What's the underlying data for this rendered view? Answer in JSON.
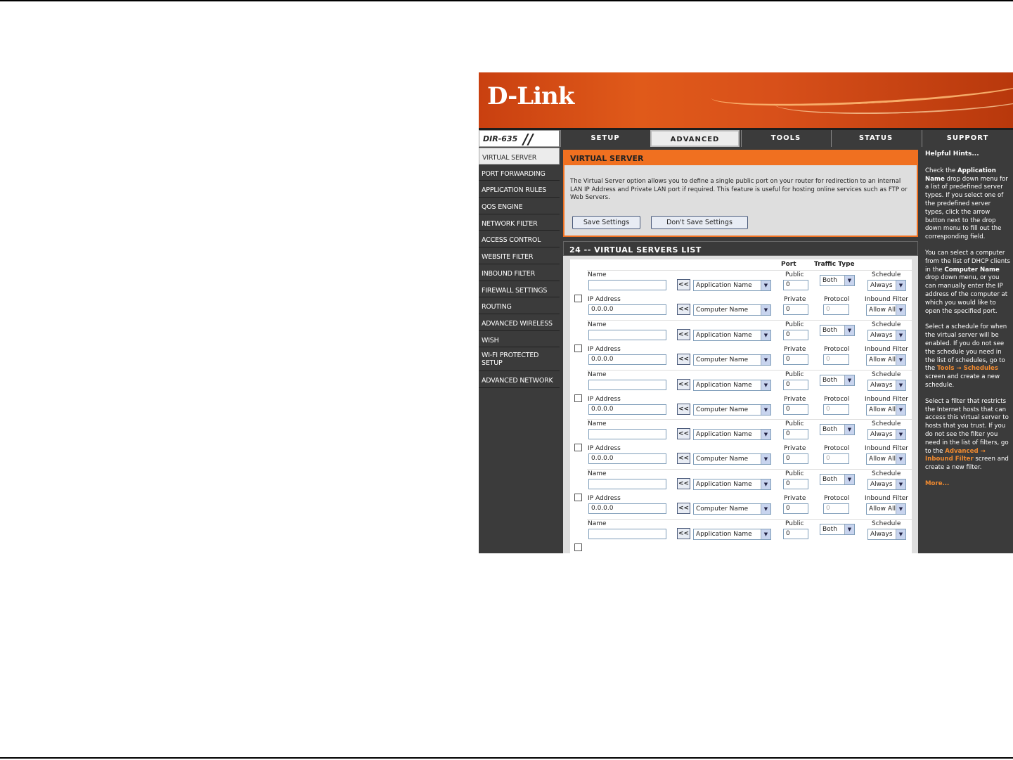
{
  "brand": {
    "logo": "D-Link",
    "model": "DIR-635"
  },
  "tabs": [
    "SETUP",
    "ADVANCED",
    "TOOLS",
    "STATUS",
    "SUPPORT"
  ],
  "active_tab": "ADVANCED",
  "sidebar": {
    "items": [
      {
        "label": "VIRTUAL SERVER"
      },
      {
        "label": "PORT FORWARDING"
      },
      {
        "label": "APPLICATION RULES"
      },
      {
        "label": "QOS ENGINE"
      },
      {
        "label": "NETWORK FILTER"
      },
      {
        "label": "ACCESS CONTROL"
      },
      {
        "label": "WEBSITE FILTER"
      },
      {
        "label": "INBOUND FILTER"
      },
      {
        "label": "FIREWALL SETTINGS"
      },
      {
        "label": "ROUTING"
      },
      {
        "label": "ADVANCED WIRELESS"
      },
      {
        "label": "WISH"
      },
      {
        "label": "WI-FI PROTECTED SETUP"
      },
      {
        "label": "ADVANCED NETWORK"
      }
    ],
    "active": "VIRTUAL SERVER"
  },
  "virtual_server": {
    "title": "VIRTUAL SERVER",
    "description": "The Virtual Server option allows you to define a single public port on your router for redirection to an internal LAN IP Address and Private LAN port if required. This feature is useful for hosting online services such as FTP or Web Servers.",
    "save_label": "Save Settings",
    "dont_save_label": "Don't Save Settings"
  },
  "list": {
    "title": "24 -- VIRTUAL SERVERS LIST",
    "col_port": "Port",
    "col_traffic": "Traffic Type",
    "labels": {
      "name": "Name",
      "ip": "IP Address",
      "public": "Public",
      "private": "Private",
      "protocol": "Protocol",
      "schedule": "Schedule",
      "inbound": "Inbound Filter",
      "arrow": "<<"
    },
    "rows": [
      {
        "name": "",
        "ip": "0.0.0.0",
        "app": "Application Name",
        "computer": "Computer Name",
        "public": "0",
        "private": "0",
        "traffic": "Both",
        "protocol": "0",
        "schedule": "Always",
        "inbound": "Allow All"
      },
      {
        "name": "",
        "ip": "0.0.0.0",
        "app": "Application Name",
        "computer": "Computer Name",
        "public": "0",
        "private": "0",
        "traffic": "Both",
        "protocol": "0",
        "schedule": "Always",
        "inbound": "Allow All"
      },
      {
        "name": "",
        "ip": "0.0.0.0",
        "app": "Application Name",
        "computer": "Computer Name",
        "public": "0",
        "private": "0",
        "traffic": "Both",
        "protocol": "0",
        "schedule": "Always",
        "inbound": "Allow All"
      },
      {
        "name": "",
        "ip": "0.0.0.0",
        "app": "Application Name",
        "computer": "Computer Name",
        "public": "0",
        "private": "0",
        "traffic": "Both",
        "protocol": "0",
        "schedule": "Always",
        "inbound": "Allow All"
      },
      {
        "name": "",
        "ip": "0.0.0.0",
        "app": "Application Name",
        "computer": "Computer Name",
        "public": "0",
        "private": "0",
        "traffic": "Both",
        "protocol": "0",
        "schedule": "Always",
        "inbound": "Allow All"
      },
      {
        "name": "",
        "ip": "",
        "app": "Application Name",
        "computer": "",
        "public": "0",
        "private": "",
        "traffic": "Both",
        "protocol": "",
        "schedule": "Always",
        "inbound": ""
      }
    ]
  },
  "hints": {
    "title": "Helpful Hints...",
    "p1_a": "Check the ",
    "p1_b": "Application Name",
    "p1_c": " drop down menu for a list of predefined server types. If you select one of the predefined server types, click the arrow button next to the drop down menu to fill out the corresponding field.",
    "p2_a": "You can select a computer from the list of DHCP clients in the ",
    "p2_b": "Computer Name",
    "p2_c": " drop down menu, or you can manually enter the IP address of the computer at which you would like to open the specified port.",
    "p3_a": "Select a schedule for when the virtual server will be enabled. If you do not see the schedule you need in the list of schedules, go to the ",
    "p3_b": "Tools → Schedules",
    "p3_c": " screen and create a new schedule.",
    "p4_a": "Select a filter that restricts the Internet hosts that can access this virtual server to hosts that you trust. If you do not see the filter you need in the list of filters, go to the ",
    "p4_b": "Advanced → Inbound Filter",
    "p4_c": " screen and create a new filter.",
    "more": "More..."
  },
  "colors": {
    "accent": "#f07020",
    "panel": "#3b3b3b",
    "box": "#dedede"
  }
}
